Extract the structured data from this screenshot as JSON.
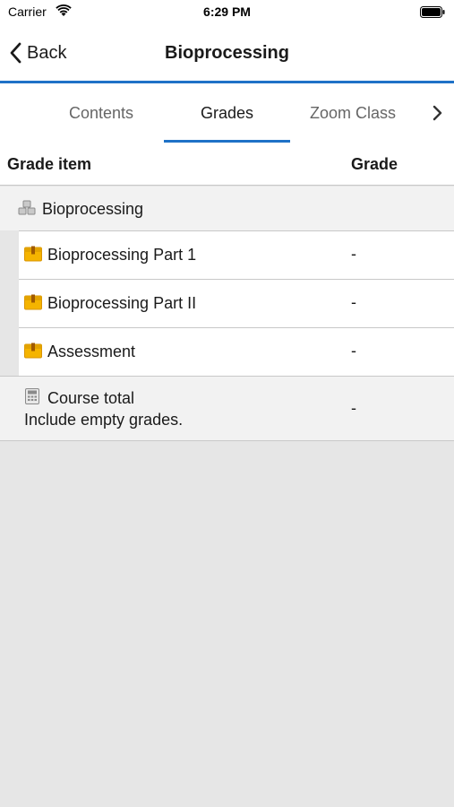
{
  "status": {
    "carrier": "Carrier",
    "time": "6:29 PM"
  },
  "nav": {
    "back_label": "Back",
    "title": "Bioprocessing"
  },
  "tabs": [
    {
      "label": "Contents",
      "active": false
    },
    {
      "label": "Grades",
      "active": true
    },
    {
      "label": "Zoom Class",
      "active": false
    }
  ],
  "table": {
    "header_item": "Grade item",
    "header_grade": "Grade",
    "category": {
      "label": "Bioprocessing",
      "icon": "category-icon"
    },
    "items": [
      {
        "label": "Bioprocessing Part 1",
        "grade": "-",
        "icon": "assignment-icon"
      },
      {
        "label": "Bioprocessing Part II",
        "grade": "-",
        "icon": "assignment-icon"
      },
      {
        "label": "Assessment",
        "grade": "-",
        "icon": "assignment-icon"
      }
    ],
    "total": {
      "label": "Course total",
      "sublabel": "Include empty grades.",
      "grade": "-",
      "icon": "calculator-icon"
    }
  },
  "colors": {
    "accent": "#1f72c7",
    "background": "#e6e6e6",
    "icon_yellow": "#f5b400"
  }
}
